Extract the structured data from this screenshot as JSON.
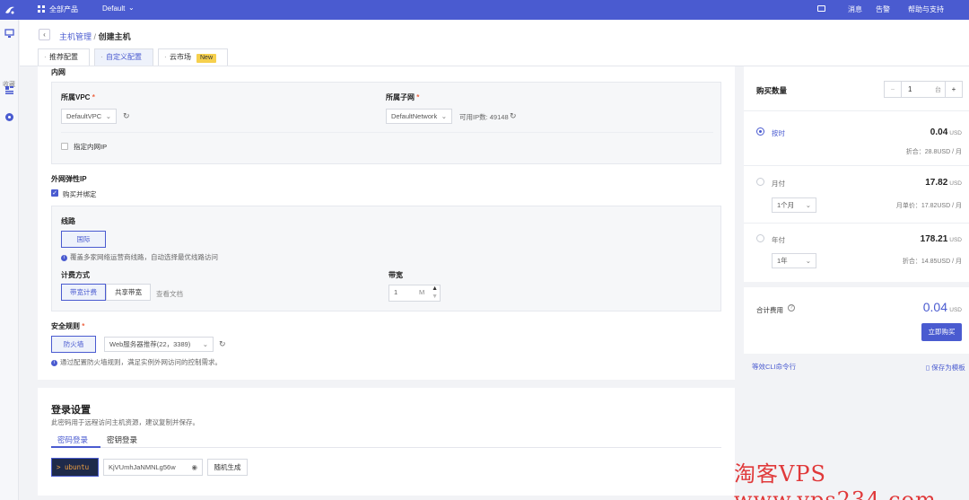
{
  "topbar": {
    "all_products": "全部产品",
    "project": "Default",
    "messages": "消息",
    "alerts": "告警",
    "help": "帮助与支持"
  },
  "leftnav": {
    "favorites": "收藏"
  },
  "header": {
    "crumb_parent": "主机管理",
    "crumb_sep": "/",
    "crumb_current": "创建主机",
    "tabs": [
      {
        "label": "推荐配置"
      },
      {
        "label": "自定义配置"
      },
      {
        "label": "云市场",
        "badge": "New"
      }
    ]
  },
  "network": {
    "title": "内网",
    "vpc_label": "所属VPC",
    "vpc_value": "DefaultVPC",
    "subnet_label": "所属子网",
    "subnet_value": "DefaultNetwork",
    "available_ip": "可用IP数: 49148",
    "specify_ip": "指定内网IP",
    "required_mark": "*"
  },
  "eip": {
    "title": "外网弹性IP",
    "buy_bind": "购买并绑定",
    "line_label": "线路",
    "line_value": "国际",
    "line_note": "覆盖多家网络运营商线路，自动选择最优线路访问",
    "billing_label": "计费方式",
    "billing_options": [
      "带宽计费",
      "共享带宽"
    ],
    "doc_link": "查看文档",
    "bandwidth_label": "带宽",
    "bandwidth_value": "1",
    "bandwidth_unit": "M"
  },
  "security": {
    "label": "安全规则",
    "firewall": "防火墙",
    "rule_value": "Web服务器推荐(22，3389)",
    "note": "通过配置防火墙规则，满足实例外网访问的控制需求。"
  },
  "login": {
    "title": "登录设置",
    "desc": "此密码用于远程访问主机资源，建议复制并保存。",
    "tabs": [
      "密码登录",
      "密钥登录"
    ],
    "user": "> ubuntu",
    "password": "KjVUmhJaNMNLg56w",
    "generate": "随机生成"
  },
  "purchase": {
    "qty_label": "购买数量",
    "qty_value": "1",
    "qty_unit": "台",
    "minus": "−",
    "plus": "+",
    "hourly": {
      "label": "按时",
      "price": "0.04",
      "unit": "USD",
      "note": "折合：28.8USD / 月"
    },
    "monthly": {
      "label": "月付",
      "price": "17.82",
      "unit": "USD",
      "period": "1个月",
      "note": "月单价：17.82USD / 月"
    },
    "yearly": {
      "label": "年付",
      "price": "178.21",
      "unit": "USD",
      "period": "1年",
      "note": "折合：14.85USD / 月"
    },
    "total_label": "合计费用",
    "total_value": "0.04",
    "total_unit": "USD",
    "buy_now": "立即购买",
    "cli": "等效CLI命令行",
    "save_template": "保存为模板"
  },
  "watermark": "淘客VPS www.vps234.com",
  "colors": {
    "accent": "#4a5bd0",
    "topbar": "#4a5bd0",
    "badge": "#f6d04d"
  }
}
